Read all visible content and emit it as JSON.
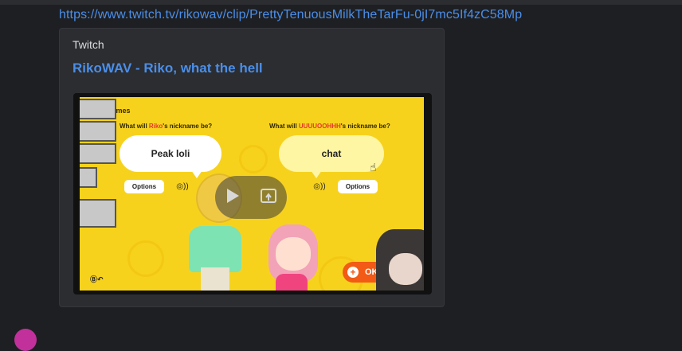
{
  "message": {
    "link_text": "https://www.twitch.tv/rikowav/clip/PrettyTenuousMilkTheTarFu-0jI7mc5If4zC58Mp"
  },
  "embed": {
    "provider": "Twitch",
    "title": "RikoWAV - Riko, what the hell"
  },
  "video": {
    "header": "Nicknames",
    "left": {
      "question_prefix": "What will ",
      "question_name": "Riko",
      "question_suffix": "'s nickname be?",
      "bubble_text": "Peak loli",
      "options_label": "Options"
    },
    "right": {
      "question_prefix": "What will ",
      "question_name": "UUUUOOHHH",
      "question_suffix": "'s nickname be?",
      "bubble_text": "chat",
      "options_label": "Options"
    },
    "ok_label": "OK",
    "back_hint": "Ⓑ↶",
    "play_icon": "play-icon",
    "popout_icon": "popout-icon"
  },
  "colors": {
    "link": "#4b8ee8",
    "background": "#1e1f22",
    "embed_bg": "#2b2d31",
    "game_yellow": "#f7d21d",
    "ok_orange": "#f25a16",
    "name_highlight": "#e5362b"
  }
}
